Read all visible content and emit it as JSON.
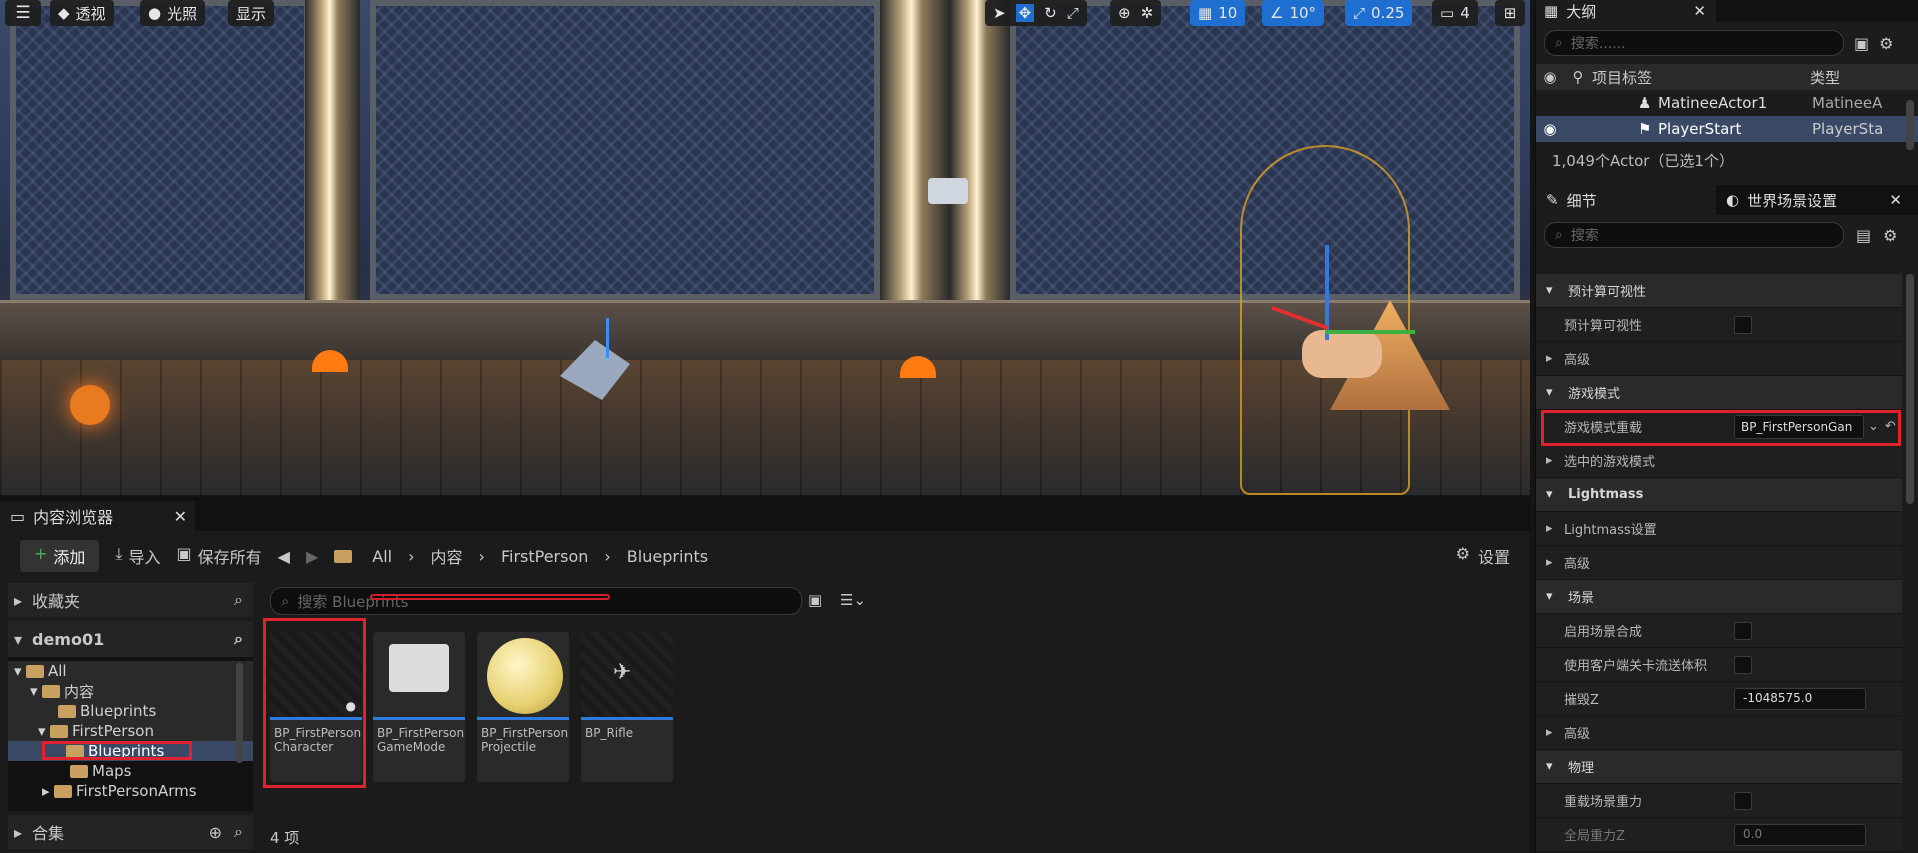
{
  "viewport": {
    "menu_icon": "hamburger-icon",
    "perspective": "透视",
    "lighting": "光照",
    "show": "显示",
    "grid_value": "10",
    "angle_value": "10°",
    "scale_value": "0.25",
    "camera_speed": "4"
  },
  "outliner": {
    "tab_title": "大纲",
    "search_placeholder": "搜索......",
    "col_label": "项目标签",
    "col_type": "类型",
    "rows": [
      {
        "name": "MatineeActor1",
        "type": "MatineeAc"
      },
      {
        "name": "PlayerStart",
        "type": "PlayerStar"
      }
    ],
    "count": "1,049个Actor（已选1个）"
  },
  "details": {
    "tab_details": "细节",
    "tab_world": "世界场景设置",
    "search_placeholder": "搜索",
    "sections": {
      "precomputed": "预计算可视性",
      "precomputed_prop": "预计算可视性",
      "advanced1": "高级",
      "gamemode": "游戏模式",
      "gamemode_override": "游戏模式重载",
      "gamemode_value": "BP_FirstPersonGan",
      "selected_gamemode": "选中的游戏模式",
      "lightmass": "Lightmass",
      "lightmass_settings": "Lightmass设置",
      "advanced2": "高级",
      "world": "场景",
      "enable_composition": "启用场景合成",
      "client_streaming": "使用客户端关卡流送体积",
      "kill_z": "摧毁Z",
      "kill_z_value": "-1048575.0",
      "advanced3": "高级",
      "physics": "物理",
      "override_gravity": "重载场景重力",
      "global_gravity": "全局重力Z",
      "global_gravity_value": "0.0"
    }
  },
  "content_browser": {
    "tab_title": "内容浏览器",
    "add": "添加",
    "import": "导入",
    "save_all": "保存所有",
    "breadcrumb": [
      "All",
      "内容",
      "FirstPerson",
      "Blueprints"
    ],
    "settings": "设置",
    "favorites": "收藏夹",
    "project": "demo01",
    "tree": [
      {
        "label": "All",
        "indent": 0
      },
      {
        "label": "内容",
        "indent": 1
      },
      {
        "label": "Blueprints",
        "indent": 2
      },
      {
        "label": "FirstPerson",
        "indent": 1
      },
      {
        "label": "Blueprints",
        "indent": 2
      },
      {
        "label": "Maps",
        "indent": 2
      },
      {
        "label": "FirstPersonArms",
        "indent": 1
      }
    ],
    "collections": "合集",
    "search_placeholder": "搜索 Blueprints",
    "assets": [
      {
        "line1": "BP_FirstPerson",
        "line2": "Character"
      },
      {
        "line1": "BP_FirstPerson",
        "line2": "GameMode"
      },
      {
        "line1": "BP_FirstPerson",
        "line2": "Projectile"
      },
      {
        "line1": "BP_Rifle",
        "line2": ""
      }
    ],
    "item_count": "4 项"
  },
  "colors": {
    "accent": "#1f6fd0",
    "highlight": "#e0222e",
    "folder": "#c9a060"
  }
}
